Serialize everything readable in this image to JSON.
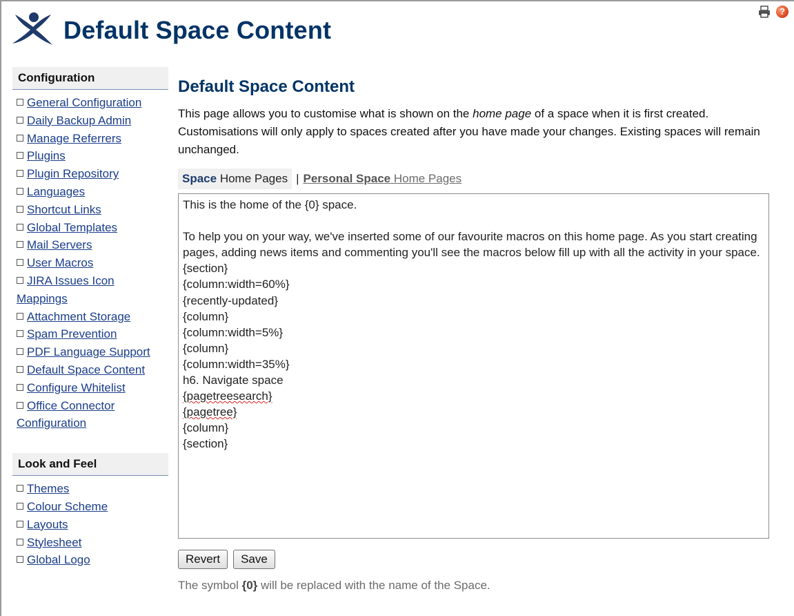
{
  "header": {
    "title": "Default Space Content",
    "logo_icon": "confluence-x-logo-icon",
    "print_icon": "printer-icon",
    "help_icon": "help-icon",
    "help_glyph": "?"
  },
  "sidebar": {
    "configuration": {
      "heading": "Configuration",
      "items": [
        "General Configuration",
        "Daily Backup Admin",
        "Manage Referrers",
        "Plugins",
        "Plugin Repository",
        "Languages",
        "Shortcut Links",
        "Global Templates",
        "Mail Servers",
        "User Macros",
        "JIRA Issues Icon Mappings",
        "Attachment Storage",
        "Spam Prevention",
        "PDF Language Support",
        "Default Space Content",
        "Configure Whitelist",
        "Office Connector Configuration"
      ]
    },
    "look_and_feel": {
      "heading": "Look and Feel",
      "items": [
        "Themes",
        "Colour Scheme",
        "Layouts",
        "Stylesheet",
        "Global Logo"
      ]
    }
  },
  "main": {
    "title": "Default Space Content",
    "intro_part1": "This page allows you to customise what is shown on the ",
    "intro_em": "home page",
    "intro_part2": " of a space when it is first created. Customisations will only apply to spaces created after you have made your changes. Existing spaces will remain unchanged.",
    "tabs": {
      "space_bold": "Space",
      "space_rest": " Home Pages",
      "separator": "|",
      "personal_bold": "Personal Space",
      "personal_rest": " Home Pages"
    },
    "editor_lines": [
      "This is the home of the {0} space.",
      "",
      "To help you on your way, we've inserted some of our favourite macros on this home page. As you start creating pages, adding news items and commenting you'll see the macros below fill up with all the activity in your space.",
      "{section}",
      "{column:width=60%}",
      "{recently-updated}",
      "{column}",
      "{column:width=5%}",
      "{column}",
      "{column:width=35%}",
      "h6. Navigate space",
      "{pagetreesearch}",
      "{pagetree}",
      "{column}",
      "{section}"
    ],
    "buttons": {
      "revert": "Revert",
      "save": "Save"
    },
    "note_before": "The symbol ",
    "note_symbol": "{0}",
    "note_after": " will be replaced with the name of the Space."
  }
}
